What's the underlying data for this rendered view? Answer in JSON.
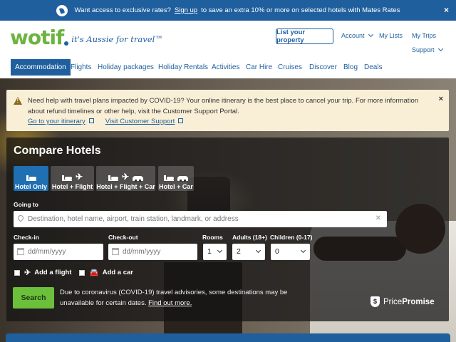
{
  "banner": {
    "text": "Want access to exclusive rates?",
    "signup_label": "Sign up",
    "tail": "to save an extra 10% or more on selected hotels with Mates Rates",
    "close": "×"
  },
  "header": {
    "logo_word": "wotif",
    "logo_tagline": "it's Aussie for travel™",
    "list_property": "List your property",
    "account": "Account",
    "my_lists": "My Lists",
    "my_trips": "My Trips",
    "support": "Support"
  },
  "nav": {
    "items": [
      "Accommodation",
      "Flights",
      "Holiday packages",
      "Holiday Rentals",
      "Activities",
      "Car Hire",
      "Cruises",
      "Discover",
      "Blog",
      "Deals"
    ]
  },
  "alert": {
    "message": "Need help with travel plans impacted by COVID-19? Your online itinerary is the best place to cancel your trip. For more information about refund timelines or other help, visit the Customer Support Portal.",
    "link1": "Go to your itinerary",
    "link2": "Visit Customer Support",
    "close": "×"
  },
  "search": {
    "title": "Compare Hotels",
    "tabs": [
      {
        "label": "Hotel Only",
        "icons": [
          "bed-icon"
        ]
      },
      {
        "label": "Hotel + Flight",
        "icons": [
          "bed-icon",
          "plane-icon"
        ]
      },
      {
        "label": "Hotel + Flight + Car",
        "icons": [
          "bed-icon",
          "plane-icon",
          "car-icon"
        ]
      },
      {
        "label": "Hotel + Car",
        "icons": [
          "bed-icon",
          "car-icon"
        ]
      }
    ],
    "going_to_label": "Going to",
    "destination_placeholder": "Destination, hotel name, airport, train station, landmark, or address",
    "checkin_label": "Check-in",
    "checkout_label": "Check-out",
    "date_placeholder": "dd/mm/yyyy",
    "rooms_label": "Rooms",
    "rooms_value": "1",
    "adults_label": "Adults (18+)",
    "adults_value": "2",
    "children_label": "Children (0-17)",
    "children_value": "0",
    "add_flight": "Add a flight",
    "add_car": "Add a car",
    "search_button": "Search",
    "notice": "Due to coronavirus (COVID-19) travel advisories, some destinations may be unavailable for certain dates.",
    "find_out": "Find out more.",
    "price_promise_a": "Price",
    "price_promise_b": "Promise"
  },
  "colors": {
    "brand_blue": "#1f5f9e",
    "brand_green": "#6cb33f",
    "alert_bg": "#f9efd6"
  }
}
